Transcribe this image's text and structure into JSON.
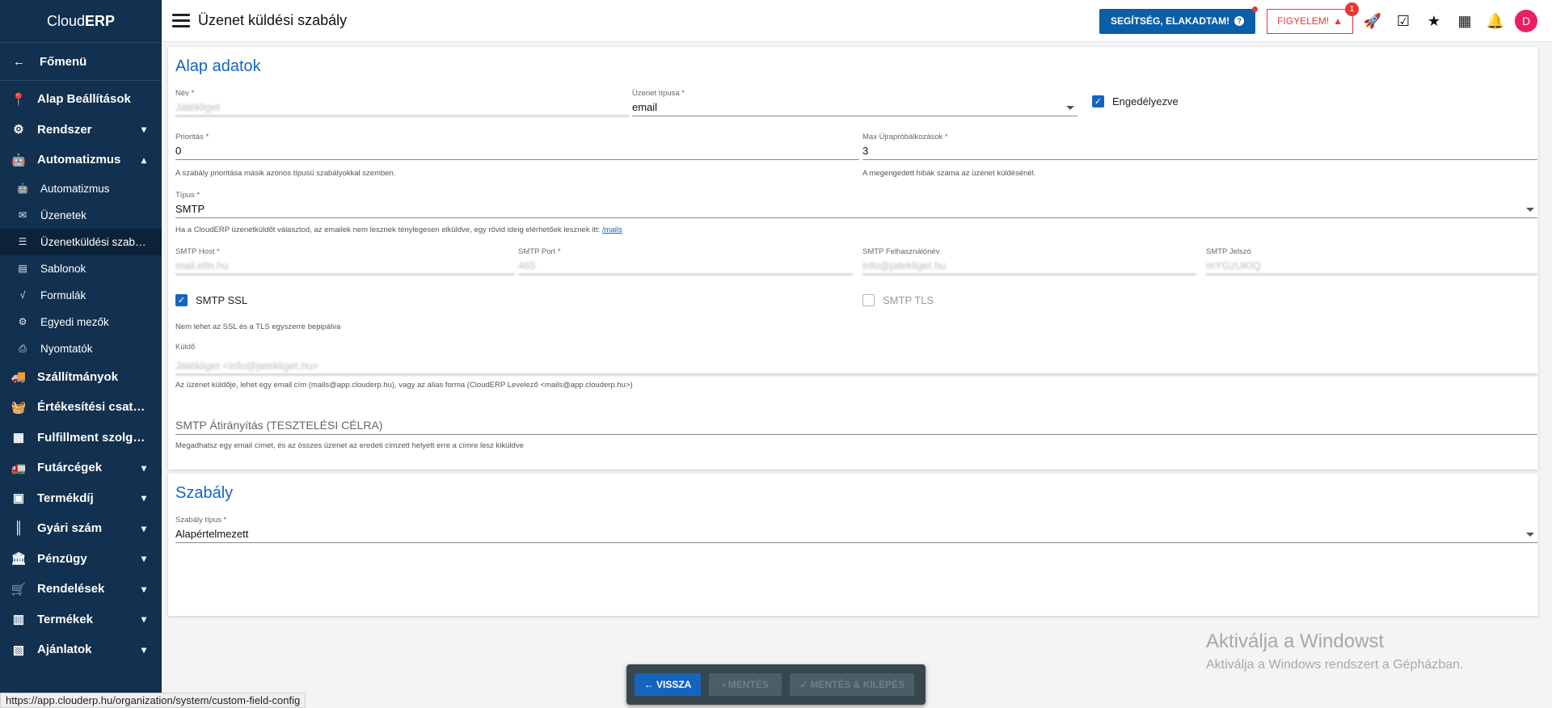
{
  "app": {
    "brand_left": "Cloud",
    "brand_right": "ERP"
  },
  "sidebar": {
    "back_label": "Főmenü",
    "items": [
      {
        "key": "alap",
        "label": "Alap Beállítások",
        "icon": "map-pin-icon",
        "chevron": ""
      },
      {
        "key": "rendszer",
        "label": "Rendszer",
        "icon": "gears-icon",
        "chevron": "down"
      },
      {
        "key": "automatizmus",
        "label": "Automatizmus",
        "icon": "robot-icon",
        "chevron": "up"
      }
    ],
    "sub_items": [
      {
        "label": "Automatizmus",
        "icon": "robot-icon"
      },
      {
        "label": "Üzenetek",
        "icon": "messages-icon"
      },
      {
        "label": "Üzenetküldési szab…",
        "icon": "sliders-icon",
        "active": true
      },
      {
        "label": "Sablonok",
        "icon": "file-icon"
      },
      {
        "label": "Formulák",
        "icon": "sqrt-icon"
      },
      {
        "label": "Egyedi mezők",
        "icon": "gears-icon"
      },
      {
        "label": "Nyomtatók",
        "icon": "printer-icon"
      }
    ],
    "items_after": [
      {
        "label": "Szállítmányok",
        "icon": "truck-icon",
        "chevron": ""
      },
      {
        "label": "Értékesítési csat…",
        "icon": "basket-icon",
        "chevron": ""
      },
      {
        "label": "Fulfillment szolg…",
        "icon": "warehouse-icon",
        "chevron": ""
      },
      {
        "label": "Futárcégek",
        "icon": "delivery-truck-icon",
        "chevron": "down"
      },
      {
        "label": "Termékdíj",
        "icon": "boxes-icon",
        "chevron": "down"
      },
      {
        "label": "Gyári szám",
        "icon": "barcode-icon",
        "chevron": "down"
      },
      {
        "label": "Pénzügy",
        "icon": "bank-icon",
        "chevron": "down"
      },
      {
        "label": "Rendelések",
        "icon": "cart-icon",
        "chevron": "down"
      },
      {
        "label": "Termékek",
        "icon": "dolly-icon",
        "chevron": "down"
      },
      {
        "label": "Ajánlatok",
        "icon": "file-invoice-icon",
        "chevron": "down"
      }
    ]
  },
  "header": {
    "title": "Üzenet küldési szabály",
    "help_label": "SEGÍTSÉG, ELAKADTAM!",
    "warn_label": "FIGYELEM!",
    "warn_count": "1",
    "avatar_letter": "D"
  },
  "basic": {
    "title": "Alap adatok",
    "name_label": "Név *",
    "name_value": "Játékliget",
    "msgtype_label": "Üzenet típusa *",
    "msgtype_value": "email",
    "enabled_label": "Engedélyezve",
    "priority_label": "Prioritás *",
    "priority_value": "0",
    "priority_hint": "A szabály prioritása másik azonos típusú szabályokkal szemben.",
    "retries_label": "Max Újrapróbálkozások *",
    "retries_value": "3",
    "retries_hint": "A megengedett hibák száma az üzenet küldésénél.",
    "type_label": "Típus *",
    "type_value": "SMTP",
    "type_hint": "Ha a CloudERP üzenetküldőt választod, az emailek nem lesznek ténylegesen elküldve, egy rövid ideig elérhetőek lesznek itt: ",
    "type_hint_link": "/mails",
    "smtp_host_label": "SMTP Host *",
    "smtp_host_value": "mail.elin.hu",
    "smtp_port_label": "SMTP Port *",
    "smtp_port_value": "465",
    "smtp_user_label": "SMTP Felhasználónév",
    "smtp_user_value": "info@jatekliget.hu",
    "smtp_pass_label": "SMTP Jelszó",
    "smtp_pass_value": "mYGzUKIQ",
    "ssl_label": "SMTP SSL",
    "tls_label": "SMTP TLS",
    "ssl_tls_hint": "Nem lehet az SSL és a TLS egyszerre bepipálva",
    "sender_label": "Küldő",
    "sender_value": "Játékliget <info@jatekliget.hu>",
    "sender_hint": "Az üzenet küldője, lehet egy email cím (mails@app.clouderp.hu), vagy az alias forma (CloudERP Levelező <mails@app.clouderp.hu>)",
    "redirect_placeholder": "SMTP Átirányítás (TESZTELÉSI CÉLRA)",
    "redirect_hint": "Megadhatsz egy email címet, és az összes üzenet az eredeti címzett helyett erre a címre lesz kiküldve"
  },
  "rule": {
    "title": "Szabály",
    "ruletype_label": "Szabály típus *",
    "ruletype_value": "Alapértelmezett"
  },
  "actions": {
    "back_label": "VISSZA",
    "save_label": "MENTÉS",
    "save_exit_label": "MENTÉS & KILÉPÉS"
  },
  "watermark": {
    "line1": "Aktiválja a Windowst",
    "line2": "Aktiválja a Windows rendszert a Gépházban."
  },
  "status_url": "https://app.clouderp.hu/organization/system/custom-field-config"
}
